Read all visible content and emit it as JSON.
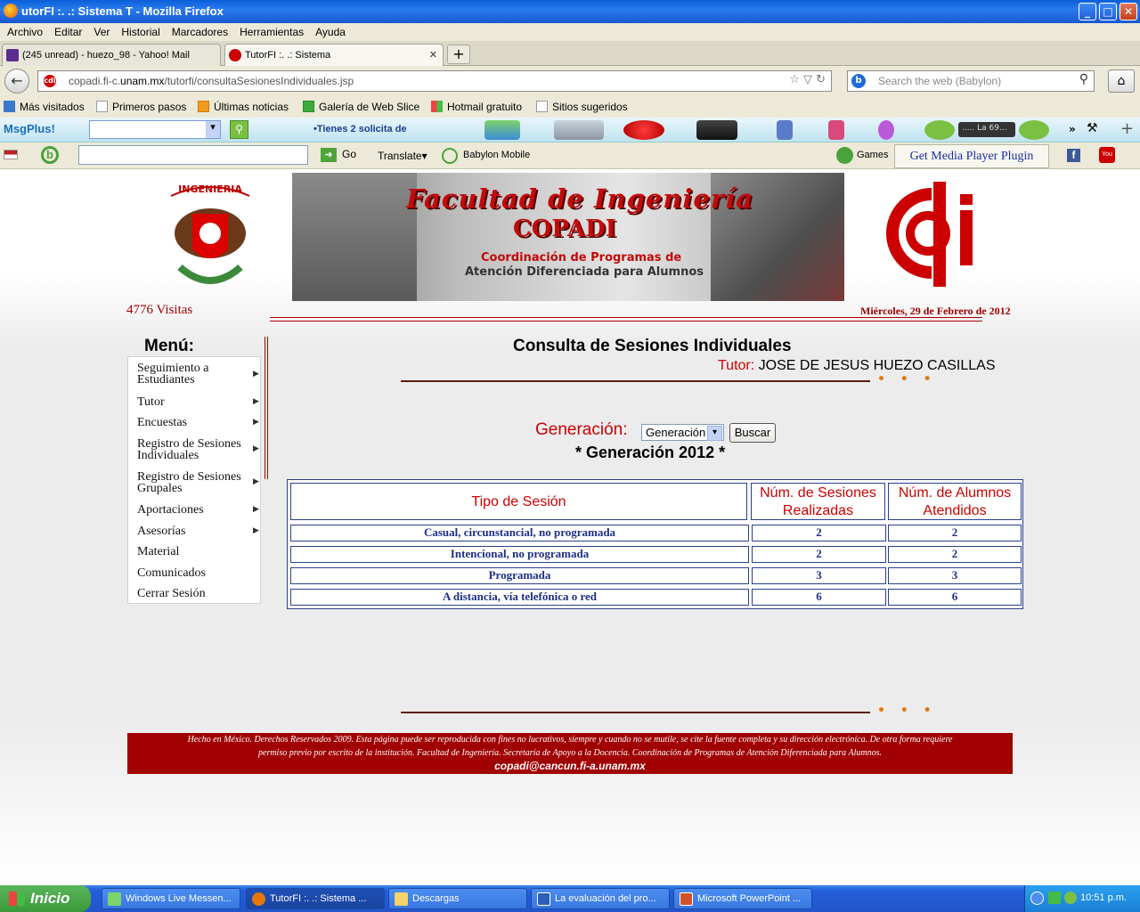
{
  "window": {
    "title": "utorFI :. .: Sistema T - Mozilla Firefox",
    "minimize": "_",
    "maximize": "□",
    "close": "✕"
  },
  "menubar": [
    "Archivo",
    "Editar",
    "Ver",
    "Historial",
    "Marcadores",
    "Herramientas",
    "Ayuda"
  ],
  "tabs": [
    {
      "label": "(245 unread) - huezo_98 - Yahoo! Mail",
      "icon": "yahoo-mail-icon"
    },
    {
      "label": "TutorFI :. .: Sistema",
      "icon": "copadi-icon"
    }
  ],
  "new_tab": "+",
  "nav": {
    "back": "←",
    "favicon": "cdi",
    "url_prefix": "copadi.fi-c.",
    "url_domain": "unam.mx",
    "url_suffix": "/tutorfi/consultaSesionesIndividuales.jsp",
    "url_icons": "☆ ▽ ↻",
    "search_engine": "b",
    "search_placeholder": "Search the web (Babylon)",
    "search_icon": "⚲",
    "home": "⌂"
  },
  "bookmarks": [
    "Más visitados",
    "Primeros pasos",
    "Últimas noticias",
    "Galería de Web Slice",
    "Hotmail gratuito",
    "Sitios sugeridos"
  ],
  "msgplus": {
    "brand": "MsgPlus!",
    "go": "⚲",
    "notice": "•Tienes 2 solicita de",
    "music": "..... La 69...",
    "more": "»",
    "plus": "+"
  },
  "babylon": {
    "go": "Go",
    "translate": "Translate",
    "mobile": "Babylon Mobile",
    "games": "Games",
    "get_media": "Get Media Player Plugin"
  },
  "header": {
    "crest_text": "INGENIERIA",
    "banner_title": "Facultad de Ingeniería",
    "banner_sub": "COPADI",
    "banner_line1": "Coordinación de Programas de",
    "banner_line2": "Atención Diferenciada para Alumnos",
    "visitas": "4776 Visitas",
    "fecha": "Miércoles, 29 de Febrero de 2012"
  },
  "sidebar": {
    "title": "Menú:",
    "items": [
      {
        "label": "Seguimiento a Estudiantes",
        "arrow": "▶"
      },
      {
        "label": "Tutor",
        "arrow": "▶"
      },
      {
        "label": "Encuestas",
        "arrow": "▶"
      },
      {
        "label": "Registro de Sesiones Individuales",
        "arrow": "▶"
      },
      {
        "label": "Registro de Sesiones Grupales",
        "arrow": "▶"
      },
      {
        "label": "Aportaciones",
        "arrow": "▶"
      },
      {
        "label": "Asesorías",
        "arrow": "▶"
      },
      {
        "label": "Material",
        "arrow": ""
      },
      {
        "label": "Comunicados",
        "arrow": ""
      },
      {
        "label": "Cerrar Sesión",
        "arrow": ""
      }
    ]
  },
  "main": {
    "title": "Consulta de Sesiones Individuales",
    "tutor_label": "Tutor:",
    "tutor_name": "JOSE DE JESUS HUEZO CASILLAS",
    "dots": "• • •",
    "generacion_label": "Generación:",
    "generacion_value": "Generación",
    "buscar": "Buscar",
    "generacion_title": "* Generación 2012 *",
    "table": {
      "headers": [
        "Tipo de Sesión",
        "Núm. de Sesiones Realizadas",
        "Núm. de Alumnos Atendidos"
      ],
      "rows": [
        [
          "Casual, circunstancial, no programada",
          "2",
          "2"
        ],
        [
          "Intencional, no programada",
          "2",
          "2"
        ],
        [
          "Programada",
          "3",
          "3"
        ],
        [
          "A distancia, vía telefónica o red",
          "6",
          "6"
        ]
      ]
    }
  },
  "footer": {
    "line1": "Hecho en México. Derechos Reservados 2009. Esta página puede ser reproducida con fines no lucrativos, siempre y cuando no se mutile, se cite la fuente completa y su dirección electrónica. De otra forma requiere",
    "line2": "permiso previo por escrito de la institución. Facultad de Ingeniería. Secretaría de Apoyo a la Docencia. Coordinación de Programas de Atención Diferenciada para Alumnos.",
    "email": "copadi@cancun.fi-a.unam.mx"
  },
  "taskbar": {
    "start": "Inicio",
    "tasks": [
      "Windows Live Messen...",
      "TutorFI :. .: Sistema ...",
      "Descargas",
      "La evaluación del pro...",
      "Microsoft PowerPoint ..."
    ],
    "time": "10:51 p.m."
  },
  "colors": {
    "accent_red": "#c00000",
    "table_blue": "#1d2f8a",
    "footer_bg": "#a00000"
  }
}
